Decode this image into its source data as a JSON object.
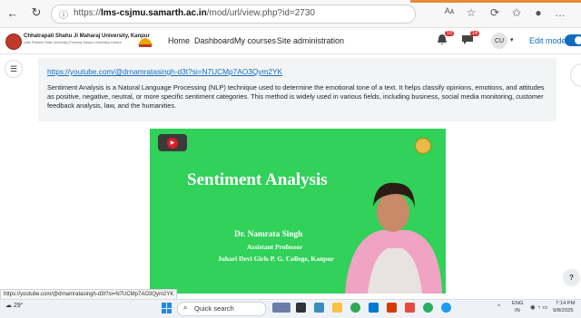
{
  "browser": {
    "url_prefix": "https://",
    "url_domain": "lms-csjmu.samarth.ac.in",
    "url_path": "/mod/url/view.php?id=2730",
    "read_aloud_label": "Aᴀ"
  },
  "site": {
    "university_name": "Chhatrapati Shahu Ji Maharaj University, Kanpur",
    "university_subtitle": "Uttar Pradesh State University (Formerly Kanpur University) Kanpur",
    "nav": {
      "home": "Home",
      "dashboard": "Dashboard",
      "my_courses": "My courses",
      "site_admin": "Site administration"
    },
    "notification_count": "10",
    "message_count": "14",
    "user_initials": "CU",
    "edit_mode_label": "Edit mode"
  },
  "content": {
    "link_text": "https://youtube.com/@drnamratasingh-d3t?si=N7UCMp7AO3Qym2YK",
    "description": "Sentiment Analysis is a Natural Language Processing (NLP) technique used to determine the emotional tone of a text. It helps classify opinions, emotions, and attitudes as positive, negative, neutral, or more specific sentiment categories. This method is widely used in various fields, including business, social media monitoring, customer feedback analysis, law, and the humanities."
  },
  "video": {
    "title": "Sentiment Analysis",
    "presenter_name": "Dr. Namrata Singh",
    "presenter_role": "Assistant Professor",
    "presenter_college": "Juhari Devi Girls P. G. College, Kanpur",
    "background_color": "#31d15a"
  },
  "status_bar": {
    "hover_url": "https://youtube.com/@drnamratasingh-d3t?si=N7UCMp7AO3Qym2YK"
  },
  "help": {
    "label": "?"
  },
  "taskbar": {
    "weather": "29°",
    "search_placeholder": "Quick search",
    "lang_top": "ENG",
    "lang_bottom": "IN",
    "time": "7:14 PM",
    "date": "9/8/2025"
  },
  "colors": {
    "accent": "#0f6cbf",
    "badge": "#d63031"
  }
}
